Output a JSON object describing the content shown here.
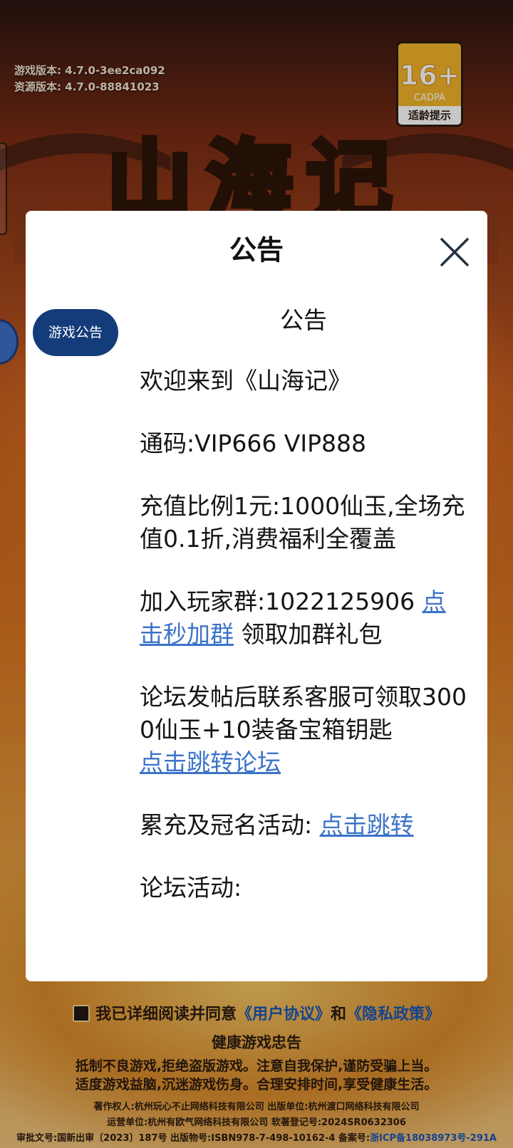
{
  "background": {
    "title_art": "山海记",
    "version": {
      "game_label": "游戏版本:",
      "game_value": "4.7.0-3ee2ca092",
      "res_label": "资源版本:",
      "res_value": "4.7.0-88841023"
    },
    "age_badge": {
      "rating": "16+",
      "org": "CADPA",
      "tip": "适龄提示"
    },
    "agreement": {
      "prefix": "我已详细阅读并同意",
      "user_agreement": "《用户协议》",
      "and": "和",
      "privacy_policy": "《隐私政策》"
    },
    "health": {
      "title": "健康游戏忠告",
      "line1": "抵制不良游戏,拒绝盗版游戏。注意自我保护,谨防受骗上当。",
      "line2": "适度游戏益脑,沉迷游戏伤身。合理安排时间,享受健康生活。"
    },
    "legal": {
      "line1": "著作权人:杭州玩心不止网络科技有限公司 出版单位:杭州渡口网络科技有限公司",
      "line2": "运营单位:杭州有欧气网络科技有限公司 软著登记号:2024SR0632306",
      "line3_prefix": "审批文号:国新出审〔2023〕187号 出版物号:ISBN978-7-498-10162-4 备案号:",
      "icp": "浙ICP备18038973号-291A"
    }
  },
  "modal": {
    "title": "公告",
    "tab_label": "游戏公告",
    "heading": "公告",
    "welcome": "欢迎来到《山海记》",
    "codes": "通码:VIP666 VIP888",
    "recharge": "充值比例1元:1000仙玉,全场充值0.1折,消费福利全覆盖",
    "group_text": "加入玩家群:1022125906 ",
    "group_link": "点击秒加群",
    "group_suffix": " 领取加群礼包",
    "forum_text": "论坛发帖后联系客服可领取3000仙玉+10装备宝箱钥匙",
    "forum_link": "点击跳转论坛",
    "event_text": "累充及冠名活动: ",
    "event_link": "点击跳转",
    "forum_activity": "论坛活动:"
  }
}
